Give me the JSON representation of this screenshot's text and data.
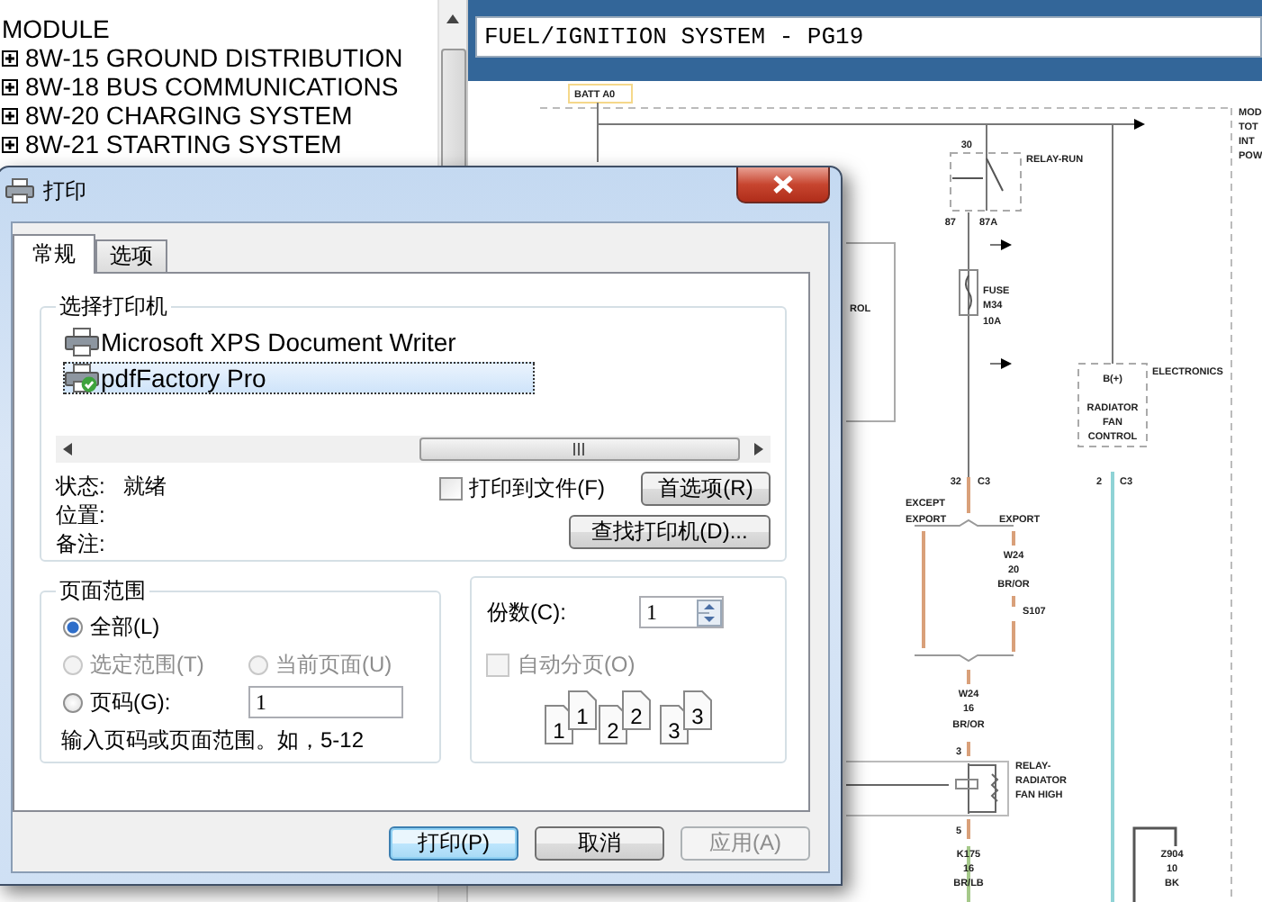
{
  "tree": {
    "items": [
      {
        "label": "MODULE",
        "expandable": false
      },
      {
        "label": "8W-15 GROUND DISTRIBUTION",
        "expandable": true
      },
      {
        "label": "8W-18 BUS COMMUNICATIONS",
        "expandable": true
      },
      {
        "label": "8W-20 CHARGING SYSTEM",
        "expandable": true
      },
      {
        "label": "8W-21 STARTING SYSTEM",
        "expandable": true
      }
    ]
  },
  "document": {
    "title": "FUEL/IGNITION SYSTEM - PG19",
    "schematic_labels": [
      "BATT A0",
      "30",
      "RELAY-RUN",
      "87",
      "87A",
      "FUSE",
      "M34",
      "10A",
      "ROL",
      "ELECTRONICS",
      "B(+)",
      "RADIATOR",
      "FAN",
      "CONTROL",
      "MOD",
      "TOT",
      "INT",
      "POW",
      "32",
      "C3",
      "2",
      "C3",
      "EXCEPT",
      "EXPORT",
      "EXPORT",
      "W24",
      "20",
      "BR/OR",
      "S107",
      "W24",
      "16",
      "BR/OR",
      "3",
      "RELAY-",
      "RADIATOR",
      "FAN HIGH",
      "5",
      "K175",
      "16",
      "BR/LB",
      "Z904",
      "10",
      "BK"
    ]
  },
  "dialog": {
    "title": "打印",
    "tabs": [
      {
        "label": "常规",
        "selected": true
      },
      {
        "label": "选项",
        "selected": false
      }
    ],
    "printer_group": {
      "title": "选择打印机",
      "printers": [
        {
          "name": "Microsoft XPS Document Writer",
          "selected": false,
          "default": false
        },
        {
          "name": "pdfFactory Pro",
          "selected": true,
          "default": true
        }
      ],
      "status_label": "状态:",
      "status_value": "就绪",
      "location_label": "位置:",
      "comment_label": "备注:",
      "print_to_file": {
        "label": "打印到文件(F)",
        "checked": false
      },
      "preferences_button": "首选项(R)",
      "find_printer_button": "查找打印机(D)..."
    },
    "page_range": {
      "title": "页面范围",
      "options": [
        {
          "label": "全部(L)",
          "selected": true,
          "disabled": false
        },
        {
          "label": "选定范围(T)",
          "selected": false,
          "disabled": true
        },
        {
          "label": "当前页面(U)",
          "selected": false,
          "disabled": true
        },
        {
          "label": "页码(G):",
          "selected": false,
          "disabled": false
        }
      ],
      "pages_value": "1",
      "hint": "输入页码或页面范围。如，5-12"
    },
    "copies": {
      "label": "份数(C):",
      "value": "1",
      "collate": {
        "label": "自动分页(O)",
        "checked": false,
        "disabled": true
      },
      "collate_numbers": [
        "1",
        "1",
        "2",
        "2",
        "3",
        "3"
      ]
    },
    "buttons": [
      {
        "label": "打印(P)",
        "default": true,
        "disabled": false
      },
      {
        "label": "取消",
        "default": false,
        "disabled": false
      },
      {
        "label": "应用(A)",
        "default": false,
        "disabled": true
      }
    ]
  }
}
